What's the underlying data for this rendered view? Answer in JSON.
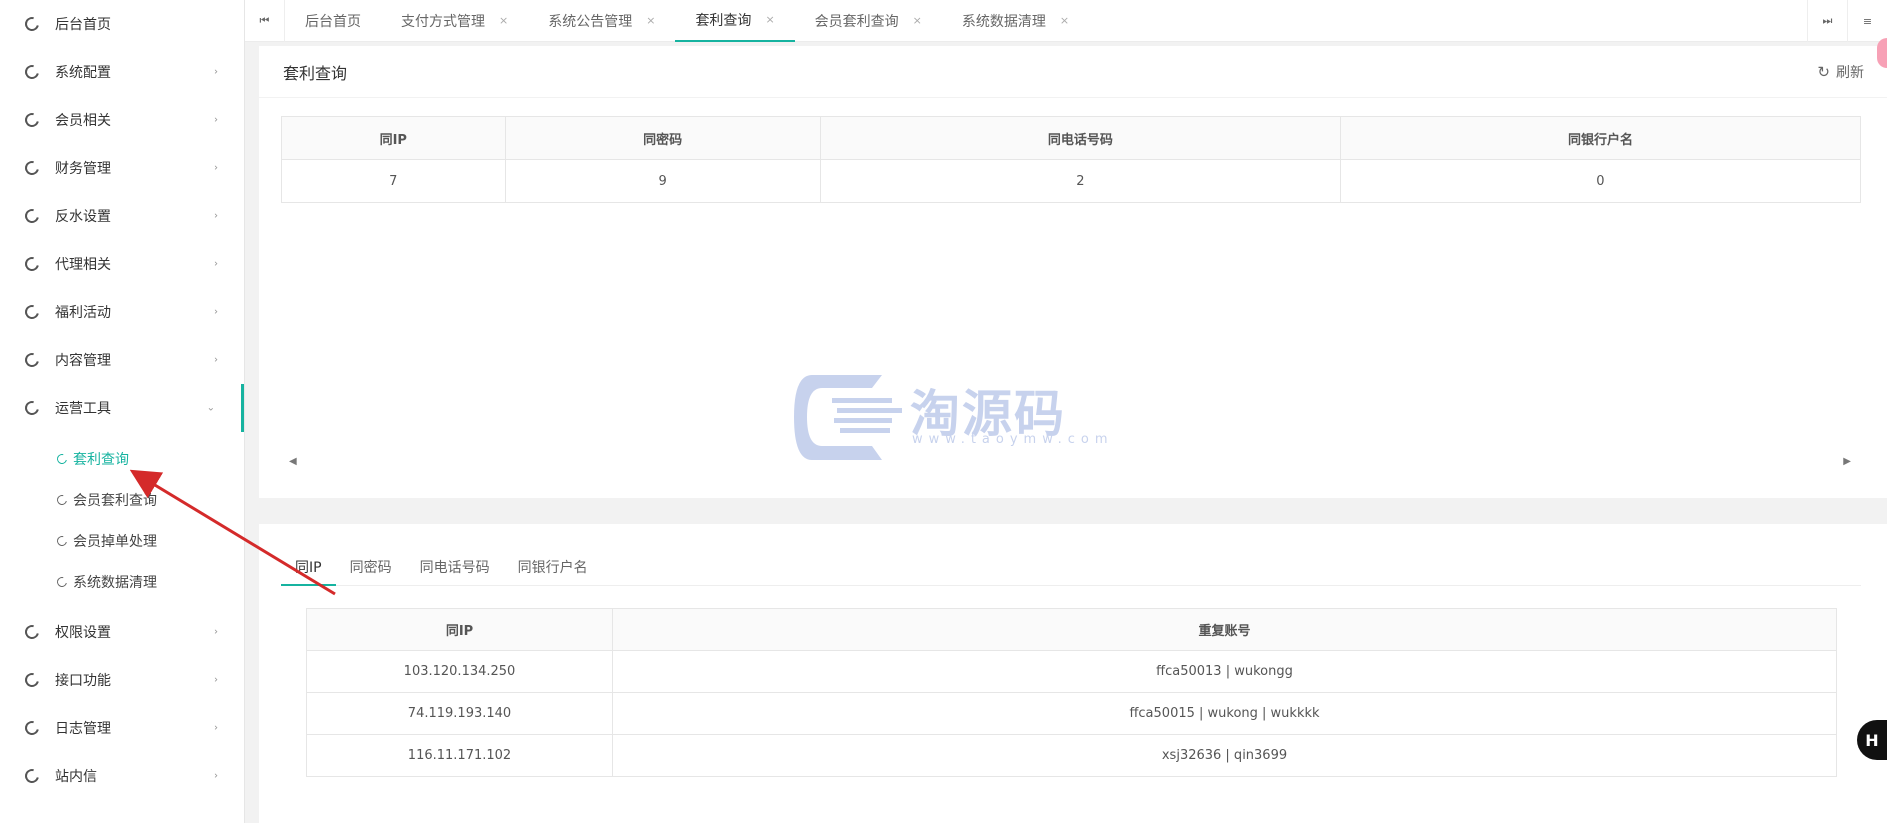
{
  "sidebar": {
    "items": [
      {
        "label": "后台首页",
        "has_children": false
      },
      {
        "label": "系统配置",
        "has_children": true
      },
      {
        "label": "会员相关",
        "has_children": true
      },
      {
        "label": "财务管理",
        "has_children": true
      },
      {
        "label": "反水设置",
        "has_children": true
      },
      {
        "label": "代理相关",
        "has_children": true
      },
      {
        "label": "福利活动",
        "has_children": true
      },
      {
        "label": "内容管理",
        "has_children": true
      },
      {
        "label": "运营工具",
        "has_children": true,
        "open": true,
        "children": [
          {
            "label": "套利查询",
            "active": true
          },
          {
            "label": "会员套利查询"
          },
          {
            "label": "会员掉单处理"
          },
          {
            "label": "系统数据清理"
          }
        ]
      },
      {
        "label": "权限设置",
        "has_children": true
      },
      {
        "label": "接口功能",
        "has_children": true
      },
      {
        "label": "日志管理",
        "has_children": true
      },
      {
        "label": "站内信",
        "has_children": true
      }
    ]
  },
  "tabs": [
    {
      "label": "后台首页",
      "closable": false
    },
    {
      "label": "支付方式管理",
      "closable": true
    },
    {
      "label": "系统公告管理",
      "closable": true
    },
    {
      "label": "套利查询",
      "closable": true,
      "active": true
    },
    {
      "label": "会员套利查询",
      "closable": true
    },
    {
      "label": "系统数据清理",
      "closable": true
    }
  ],
  "tab_close_glyph": "×",
  "main": {
    "title": "套利查询",
    "refresh_label": "刷新",
    "summary": {
      "headers": [
        "同IP",
        "同密码",
        "同电话号码",
        "同银行户名"
      ],
      "values": [
        "7",
        "9",
        "2",
        "0"
      ]
    },
    "subtabs": [
      "同IP",
      "同密码",
      "同电话号码",
      "同银行户名"
    ],
    "detail": {
      "headers": [
        "同IP",
        "重复账号"
      ],
      "rows": [
        [
          "103.120.134.250",
          "ffca50013 | wukongg"
        ],
        [
          "74.119.193.140",
          "ffca50015 | wukong | wukkkk"
        ],
        [
          "116.11.171.102",
          "xsj32636 | qin3699"
        ]
      ]
    }
  },
  "watermark": {
    "text": "淘源码",
    "sub": "www.taoymw.com"
  },
  "help_glyph": "H",
  "colors": {
    "accent": "#16b3a0",
    "annotation_arrow": "#d42a2a"
  }
}
